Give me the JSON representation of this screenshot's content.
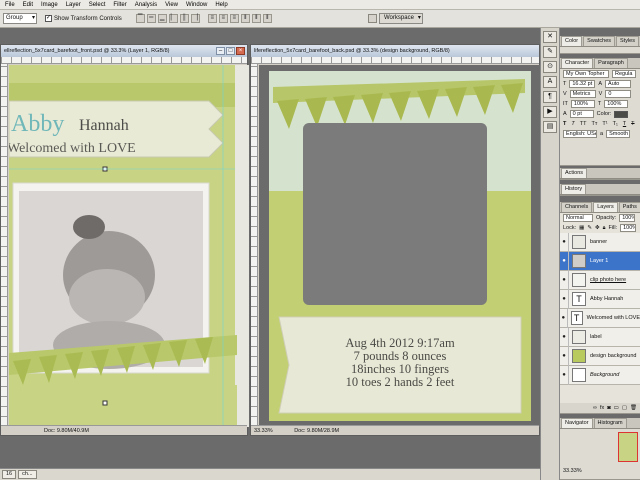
{
  "menu": [
    "File",
    "Edit",
    "Image",
    "Layer",
    "Select",
    "Filter",
    "Analysis",
    "View",
    "Window",
    "Help"
  ],
  "options": {
    "tool_preset": "Group",
    "show_transform_label": "Show Transform Controls",
    "workspace_label": "Workspace"
  },
  "doc1": {
    "title": "ellreflection_5x7card_barefoot_front.psd @ 33.3% (Layer 1, RGB/8)",
    "name_first": "Abby",
    "name_last": "Hannah",
    "tagline": "Welcomed with LOVE",
    "status_doc": "Doc: 9.80M/40.9M"
  },
  "doc2": {
    "title": "lifereflection_5x7card_barefoot_back.psd @ 33.3% (design background, RGB/8)",
    "lines": [
      "Aug 4th 2012 9:17am",
      "7 pounds 8 ounces",
      "18inches 10 fingers",
      "10 toes 2 hands 2 feet"
    ],
    "status_zoom": "33.33%",
    "status_doc": "Doc: 9.80M/28.9M"
  },
  "colorpanel": {
    "tabs": [
      "Color",
      "Swatches",
      "Styles"
    ]
  },
  "charpanel": {
    "tabs": [
      "Character",
      "Paragraph"
    ],
    "font": "My Own Topher",
    "style": "Regula",
    "size": "16.32 pt",
    "leading": "Auto",
    "tracking": "Metrics",
    "kerning": "0",
    "vscale": "100%",
    "hscale": "100%",
    "baseline": "0 pt",
    "color_label": "Color:",
    "language": "English: USA",
    "aa_label": "a",
    "aa_value": "Smooth"
  },
  "actions": {
    "tab": "Actions"
  },
  "history": {
    "tab": "History"
  },
  "layerspanel": {
    "tabs": [
      "Channels",
      "Layers",
      "Paths"
    ],
    "blend": "Normal",
    "opacity_label": "Opacity:",
    "opacity": "100%",
    "lock_label": "Lock:",
    "fill_label": "Fill:",
    "fill": "100%",
    "layers": [
      {
        "name": "banner"
      },
      {
        "name": "Layer 1"
      },
      {
        "name": "clip photo here"
      },
      {
        "name": "Abby Hannah"
      },
      {
        "name": "Welcomed with LOVE"
      },
      {
        "name": "label"
      },
      {
        "name": "design background"
      },
      {
        "name": "Background"
      }
    ]
  },
  "navigator": {
    "tabs": [
      "Navigator",
      "Histogram"
    ],
    "zoom": "33.33%"
  },
  "taskbar": {
    "items": [
      "16",
      "ch..."
    ]
  }
}
